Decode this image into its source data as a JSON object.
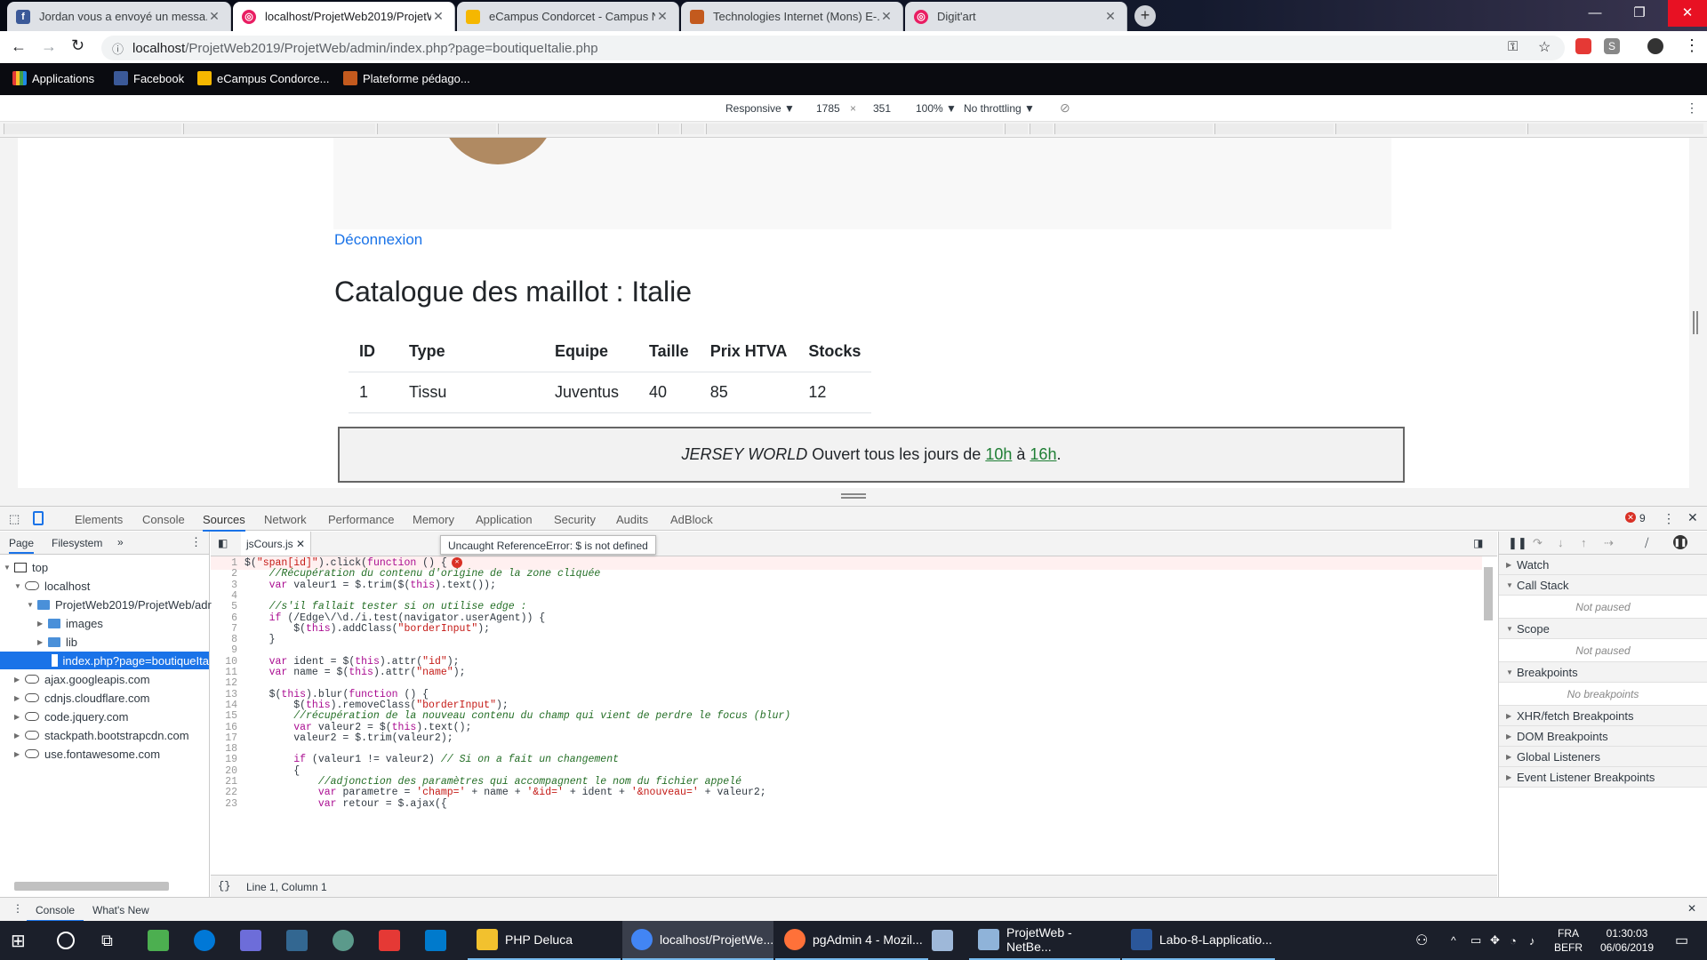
{
  "browser": {
    "tabs": [
      {
        "title": "Jordan vous a envoyé un messa...",
        "icon": "facebook-icon",
        "color": "#3b5998"
      },
      {
        "title": "localhost/ProjetWeb2019/ProjetW...",
        "icon": "pink-app-icon",
        "color": "#e91e63",
        "active": true
      },
      {
        "title": "eCampus Condorcet - Campus N...",
        "icon": "shield-icon",
        "color": "#f5b700"
      },
      {
        "title": "Technologies Internet (Mons) E-...",
        "icon": "tm-icon",
        "color": "#c35a1e"
      },
      {
        "title": "Digit'art",
        "icon": "pink-app-icon",
        "color": "#e91e63"
      }
    ],
    "url_host": "localhost",
    "url_path": "/ProjetWeb2019/ProjetWeb/admin/index.php?page=boutiqueItalie.php",
    "bookmarks": [
      {
        "label": "Applications"
      },
      {
        "label": "Facebook"
      },
      {
        "label": "eCampus Condorce..."
      },
      {
        "label": "Plateforme pédago..."
      }
    ]
  },
  "device_toolbar": {
    "mode": "Responsive",
    "width": "1785",
    "height": "351",
    "zoom": "100%",
    "throttling": "No throttling"
  },
  "page": {
    "logout_link": "Déconnexion",
    "heading": "Catalogue des maillot : Italie",
    "table": {
      "headers": [
        "ID",
        "Type",
        "Equipe",
        "Taille",
        "Prix HTVA",
        "Stocks"
      ],
      "rows": [
        [
          "1",
          "Tissu",
          "Juventus",
          "40",
          "85",
          "12"
        ]
      ]
    },
    "footer": {
      "brand": "JERSEY WORLD",
      "text1": "Ouvert tous les jours de",
      "open": "10h",
      "sep": "à",
      "close": "16h",
      "end": "."
    }
  },
  "devtools": {
    "tabs": [
      "Elements",
      "Console",
      "Sources",
      "Network",
      "Performance",
      "Memory",
      "Application",
      "Security",
      "Audits",
      "AdBlock"
    ],
    "active_tab": "Sources",
    "error_count": "9",
    "nav_tabs": [
      "Page",
      "Filesystem"
    ],
    "tree": [
      {
        "label": "top",
        "level": 0
      },
      {
        "label": "localhost",
        "level": 1
      },
      {
        "label": "ProjetWeb2019/ProjetWeb/adr",
        "level": 2
      },
      {
        "label": "images",
        "level": 3
      },
      {
        "label": "lib",
        "level": 3
      },
      {
        "label": "index.php?page=boutiqueIta",
        "level": 3,
        "selected": true
      },
      {
        "label": "ajax.googleapis.com",
        "level": 1
      },
      {
        "label": "cdnjs.cloudflare.com",
        "level": 1
      },
      {
        "label": "code.jquery.com",
        "level": 1
      },
      {
        "label": "stackpath.bootstrapcdn.com",
        "level": 1
      },
      {
        "label": "use.fontawesome.com",
        "level": 1
      }
    ],
    "file_tab": "jsCours.js",
    "error_tooltip": "Uncaught ReferenceError: $ is not defined",
    "status": "Line 1, Column 1",
    "right_sections": [
      {
        "label": "Watch",
        "note": ""
      },
      {
        "label": "Call Stack",
        "note": "Not paused"
      },
      {
        "label": "Scope",
        "note": "Not paused"
      },
      {
        "label": "Breakpoints",
        "note": "No breakpoints"
      },
      {
        "label": "XHR/fetch Breakpoints",
        "note": ""
      },
      {
        "label": "DOM Breakpoints",
        "note": ""
      },
      {
        "label": "Global Listeners",
        "note": ""
      },
      {
        "label": "Event Listener Breakpoints",
        "note": ""
      }
    ],
    "drawer_tabs": [
      "Console",
      "What's New"
    ],
    "code_lines": [
      "$(\"span[id]\").click(function () {",
      "    //Récupération du contenu d'origine de la zone cliquée",
      "    var valeur1 = $.trim($(this).text());",
      "",
      "    //s'il fallait tester si on utilise edge :",
      "    if (/Edge\\/\\d./i.test(navigator.userAgent)) {",
      "        $(this).addClass(\"borderInput\");",
      "    }",
      "",
      "    var ident = $(this).attr(\"id\");",
      "    var name = $(this).attr(\"name\");",
      "",
      "    $(this).blur(function () {",
      "        $(this).removeClass(\"borderInput\");",
      "        //récupération de la nouveau contenu du champ qui vient de perdre le focus (blur)",
      "        var valeur2 = $(this).text();",
      "        valeur2 = $.trim(valeur2);",
      "",
      "        if (valeur1 != valeur2) // Si on a fait un changement",
      "        {",
      "            //adjonction des paramètres qui accompagnent le nom du fichier appelé",
      "            var parametre = 'champ=' + name + '&id=' + ident + '&nouveau=' + valeur2;",
      "            var retour = $.ajax({"
    ]
  },
  "taskbar": {
    "apps": [
      {
        "label": "PHP Deluca",
        "color": "#f2c12e"
      },
      {
        "label": "localhost/ProjetWe...",
        "color": "#4285f4"
      },
      {
        "label": "pgAdmin 4 - Mozil...",
        "color": "#ff7139"
      },
      {
        "label": "ProjetWeb - NetBe...",
        "color": "#8fb3d9"
      },
      {
        "label": "Labo-8-Lapplicatio...",
        "color": "#2b579a"
      }
    ],
    "lang": "FRA",
    "layout": "BEFR",
    "time": "01:30:03",
    "date": "06/06/2019"
  }
}
